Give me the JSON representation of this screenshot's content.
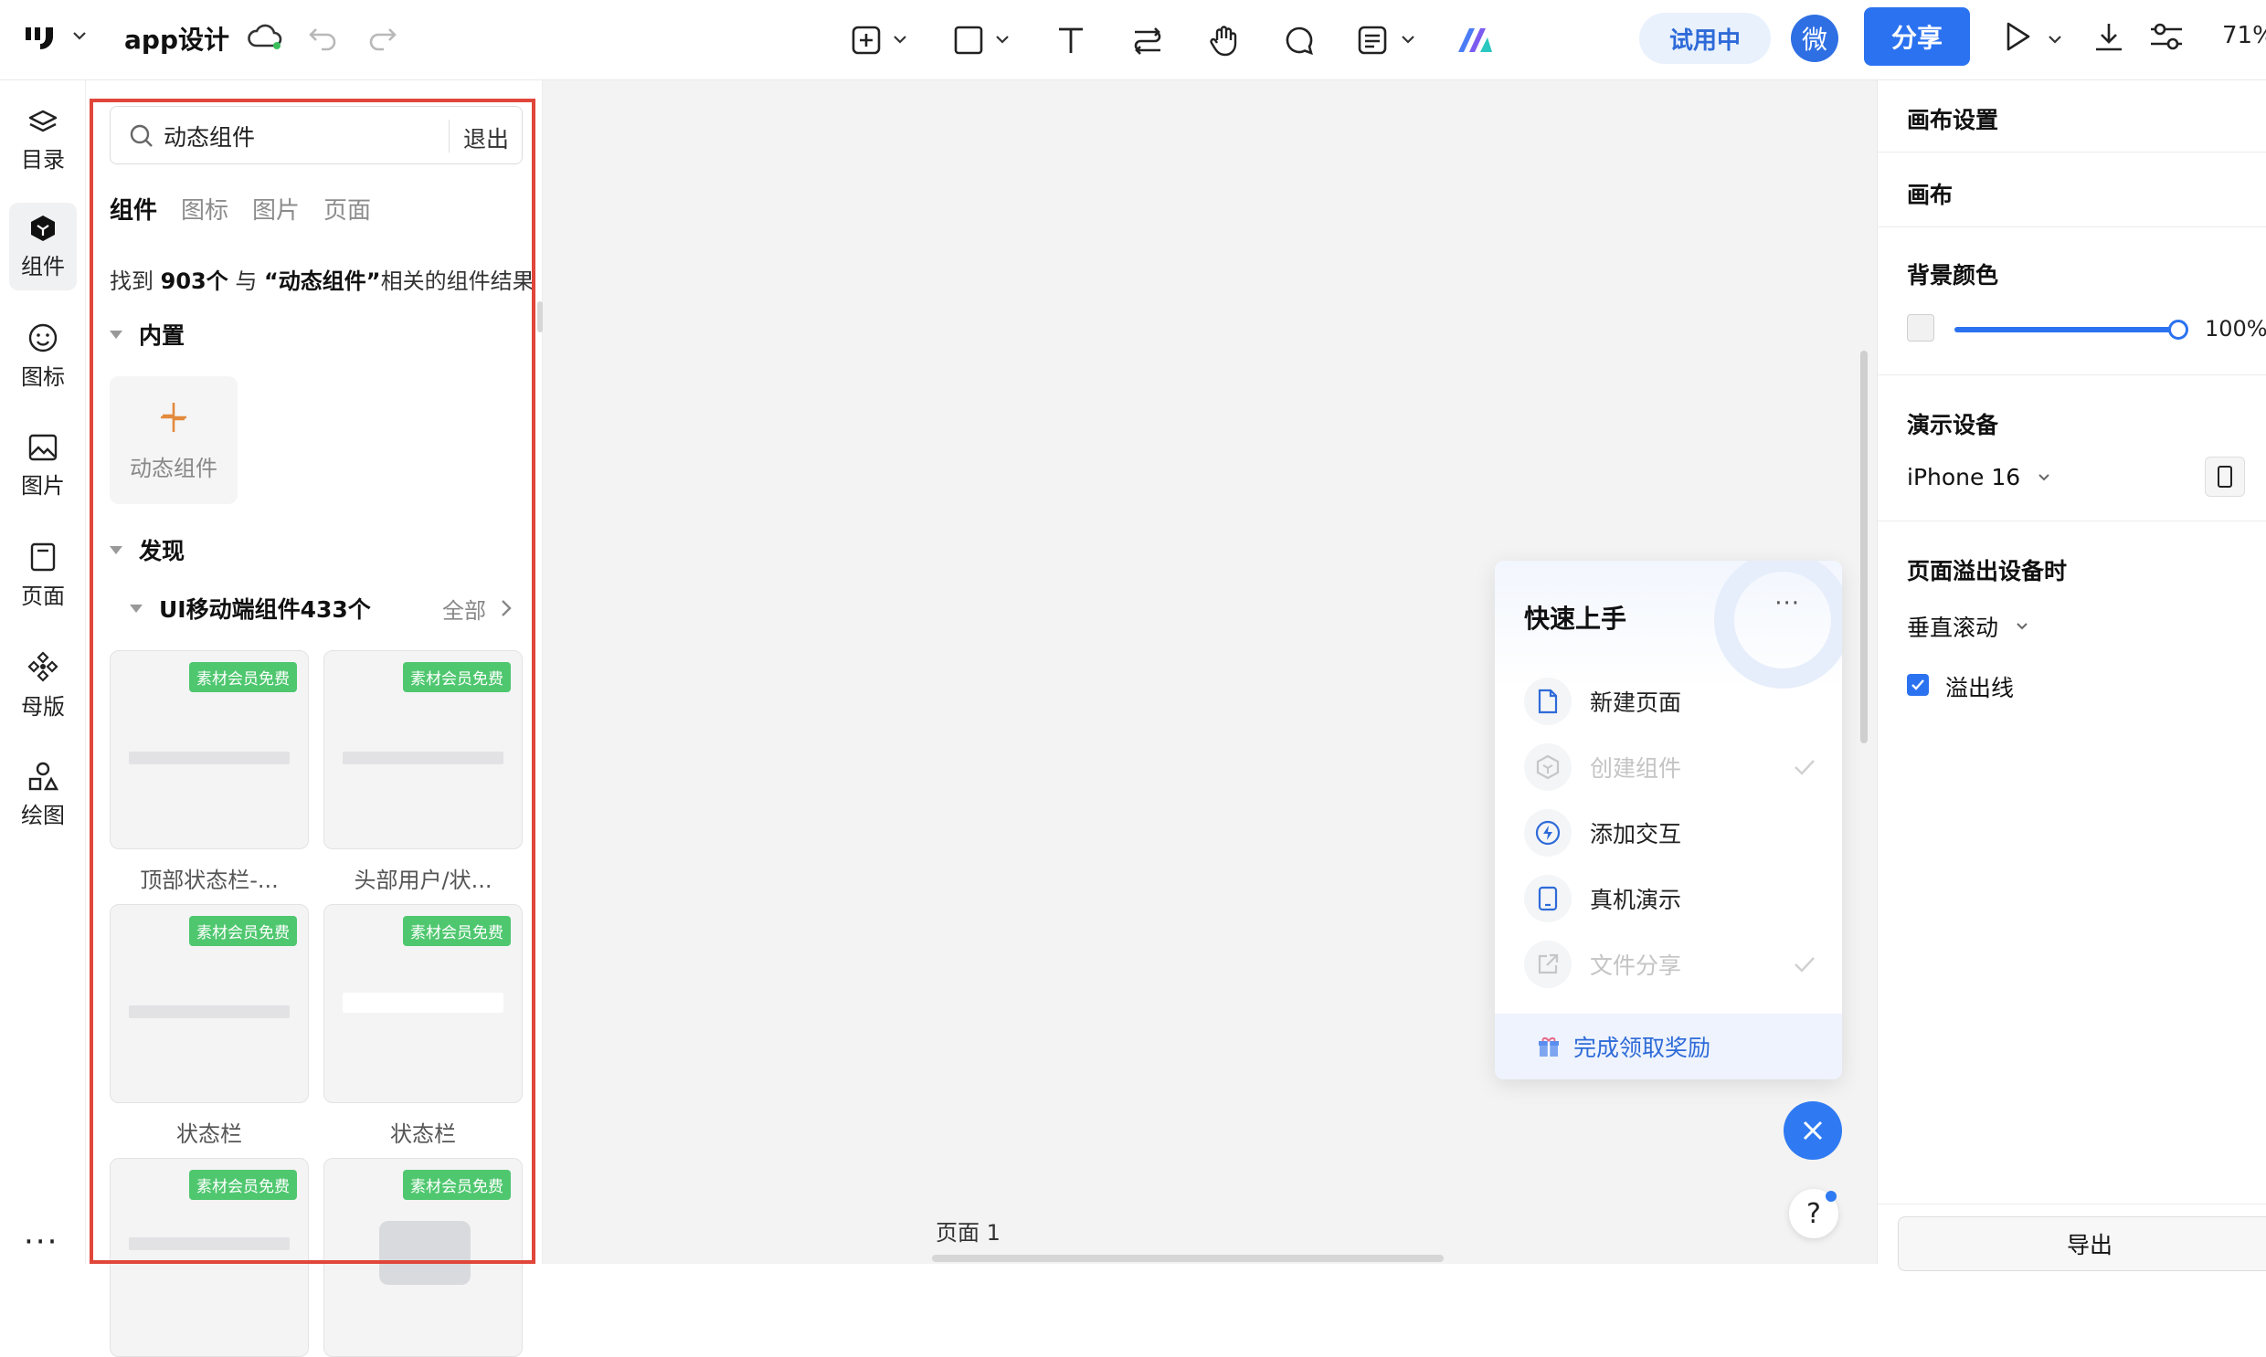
{
  "topbar": {
    "project_name": "app设计",
    "trial_label": "试用中",
    "avatar_text": "微",
    "share_label": "分享",
    "zoom": "71%"
  },
  "rail": {
    "items": [
      {
        "label": "目录",
        "icon": "layers-icon"
      },
      {
        "label": "组件",
        "icon": "component-icon"
      },
      {
        "label": "图标",
        "icon": "smiley-icon"
      },
      {
        "label": "图片",
        "icon": "image-icon"
      },
      {
        "label": "页面",
        "icon": "page-icon"
      },
      {
        "label": "母版",
        "icon": "master-icon"
      },
      {
        "label": "绘图",
        "icon": "draw-icon"
      }
    ],
    "more": "···"
  },
  "panel": {
    "search_value": "动态组件",
    "exit_label": "退出",
    "tabs": [
      "组件",
      "图标",
      "图片",
      "页面"
    ],
    "result_prefix": "找到",
    "result_count": "903个",
    "result_mid": "与",
    "result_query": "“动态组件”",
    "result_suffix": "相关的组件结果",
    "builtin_title": "内置",
    "builtin_card_label": "动态组件",
    "discover_title": "发现",
    "subsection_title": "UI移动端组件433个",
    "subsection_all": "全部",
    "badge": "素材会员免费",
    "cards": [
      {
        "caption": "顶部状态栏-..."
      },
      {
        "caption": "头部用户/状..."
      },
      {
        "caption": "状态栏"
      },
      {
        "caption": "状态栏"
      },
      {
        "caption": ""
      },
      {
        "caption": ""
      }
    ]
  },
  "canvas": {
    "page_label": "页面 1",
    "quick_start": {
      "title": "快速上手",
      "more": "···",
      "items": [
        {
          "label": "新建页面",
          "done": false,
          "icon": "file-icon"
        },
        {
          "label": "创建组件",
          "done": true,
          "icon": "cube-icon"
        },
        {
          "label": "添加交互",
          "done": false,
          "icon": "bolt-icon"
        },
        {
          "label": "真机演示",
          "done": false,
          "icon": "phone-icon"
        },
        {
          "label": "文件分享",
          "done": true,
          "icon": "share-out-icon"
        }
      ],
      "footer": "完成领取奖励"
    },
    "help": "?"
  },
  "right": {
    "canvas_settings": "画布设置",
    "canvas": "画布",
    "bg_color": "背景颜色",
    "opacity": "100%",
    "demo_device": "演示设备",
    "device_name": "iPhone 16",
    "overflow_title": "页面溢出设备时",
    "scroll_mode": "垂直滚动",
    "overflow_line": "溢出线",
    "export": "导出"
  },
  "colors": {
    "accent": "#2b72f0",
    "highlight_border": "#e0463a",
    "badge": "#4fc76f"
  }
}
